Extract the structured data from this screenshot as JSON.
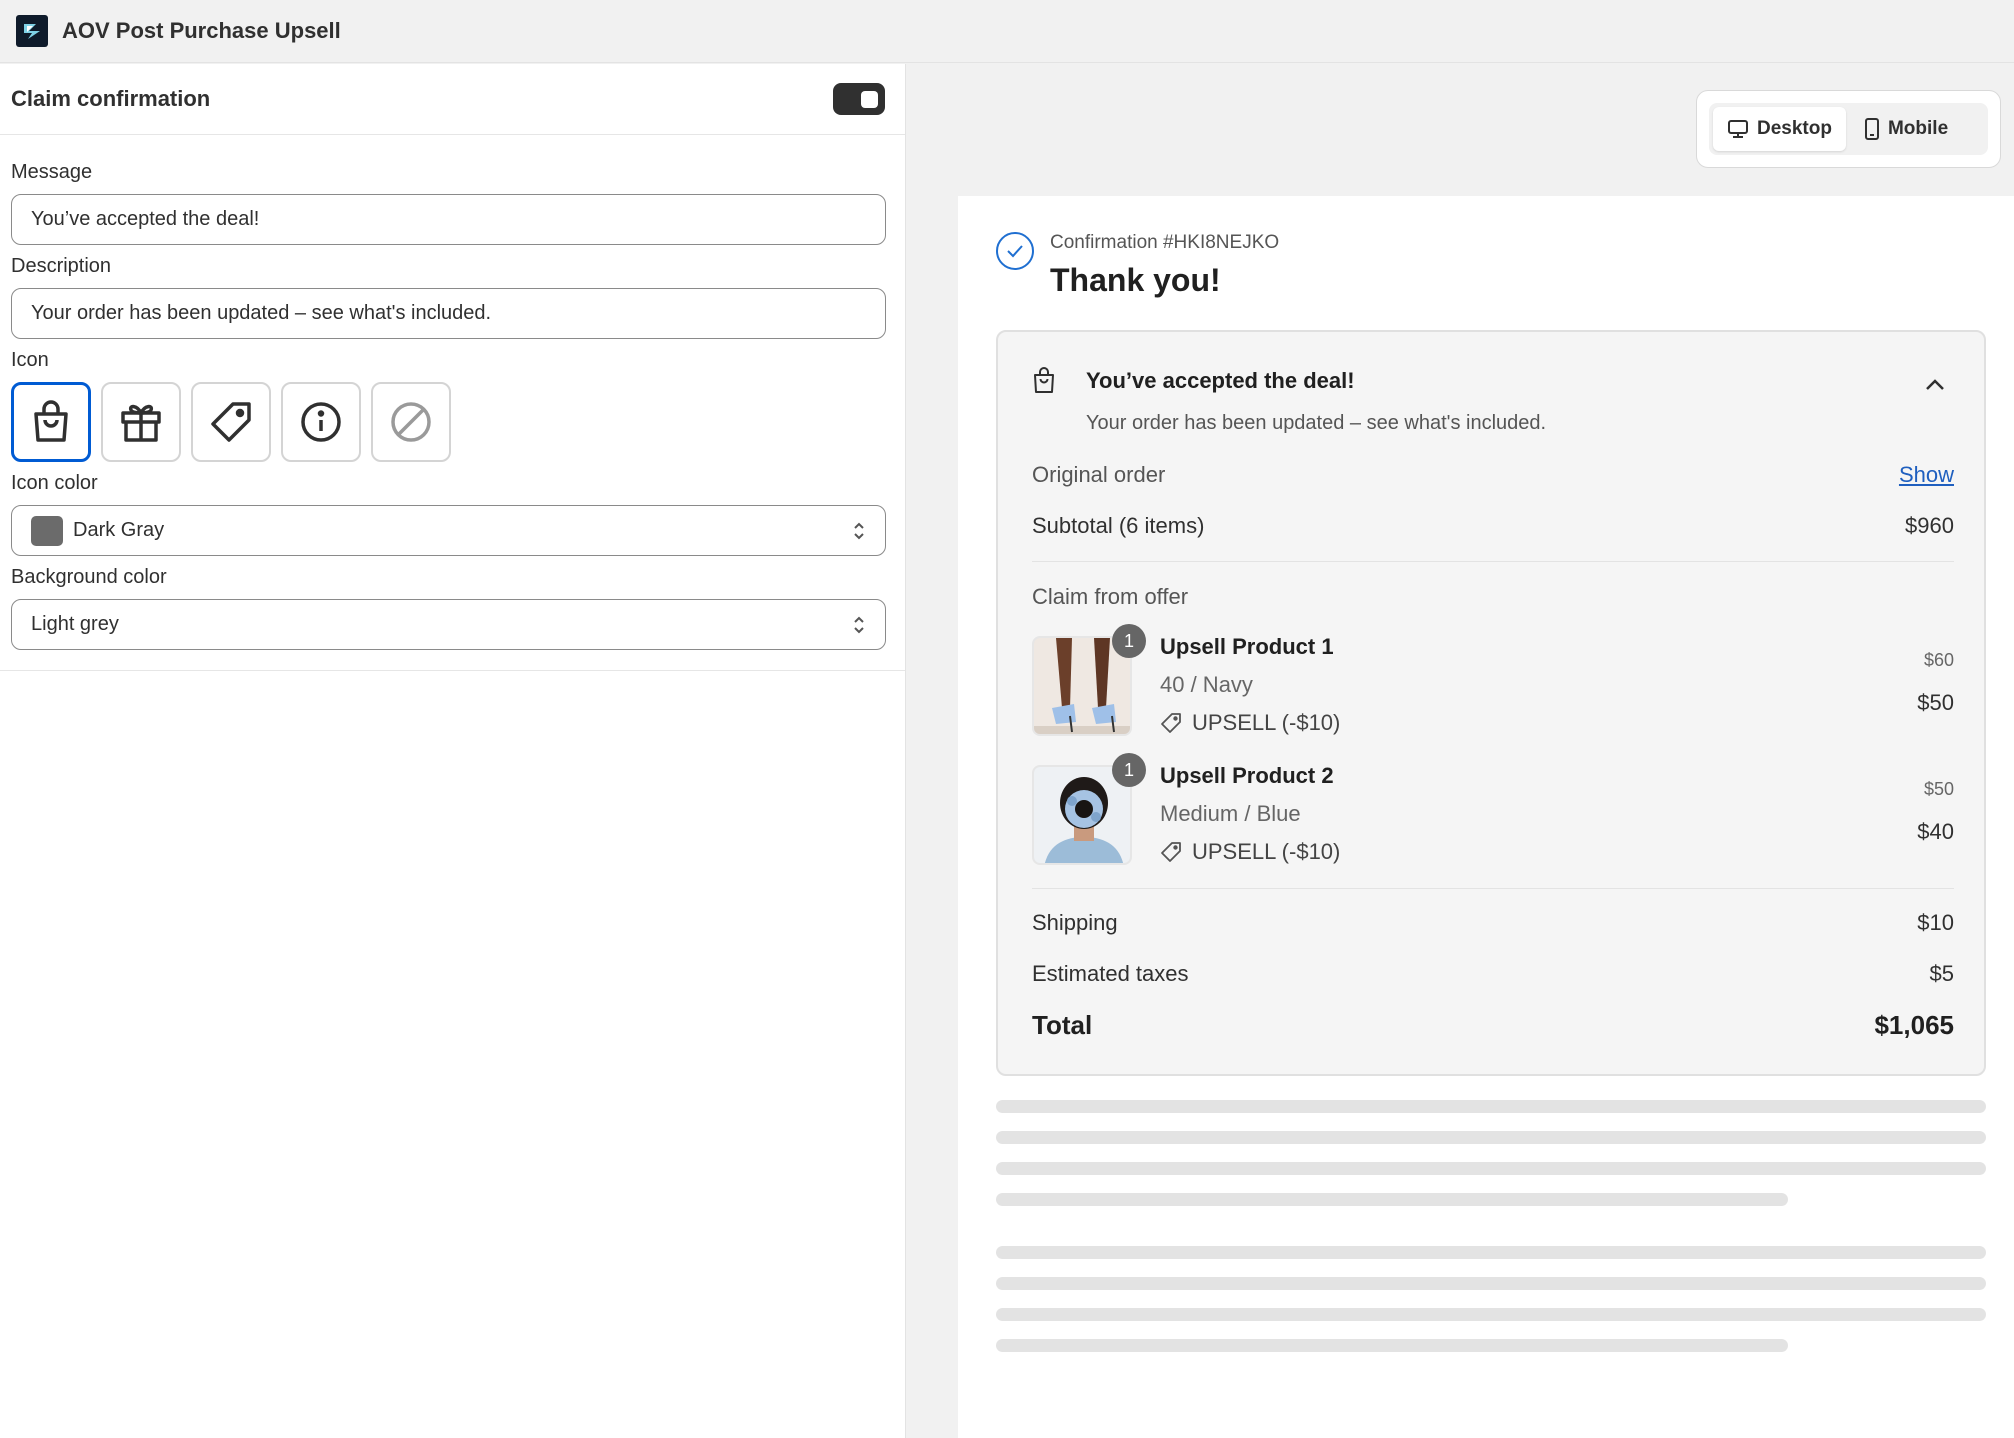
{
  "app": {
    "title": "AOV Post Purchase Upsell"
  },
  "settings": {
    "section_title": "Claim confirmation",
    "enabled": true,
    "message_label": "Message",
    "message_value": "You’ve accepted the deal!",
    "description_label": "Description",
    "description_value": "Your order has been updated – see what's included.",
    "icon_label": "Icon",
    "icons": [
      "bag-icon",
      "gift-icon",
      "tag-icon",
      "info-icon",
      "none-icon"
    ],
    "selected_icon": "bag-icon",
    "icon_color_label": "Icon color",
    "icon_color_value": "Dark Gray",
    "icon_color_hex": "#6b6b6b",
    "background_color_label": "Background color",
    "background_color_value": "Light grey"
  },
  "view_toggle": {
    "desktop": "Desktop",
    "mobile": "Mobile",
    "active": "Desktop"
  },
  "preview": {
    "confirmation_number": "Confirmation #HKI8NEJKO",
    "thank_you": "Thank you!",
    "deal_title": "You’ve accepted the deal!",
    "deal_description": "Your order has been updated – see what's included.",
    "original_order_label": "Original order",
    "show_link": "Show",
    "subtotal_label": "Subtotal (6 items)",
    "subtotal_value": "$960",
    "claim_label": "Claim from offer",
    "products": [
      {
        "qty": "1",
        "name": "Upsell Product 1",
        "variant": "40 / Navy",
        "discount": "UPSELL (-$10)",
        "old_price": "$60",
        "new_price": "$50"
      },
      {
        "qty": "1",
        "name": "Upsell Product 2",
        "variant": "Medium / Blue",
        "discount": "UPSELL (-$10)",
        "old_price": "$50",
        "new_price": "$40"
      }
    ],
    "shipping_label": "Shipping",
    "shipping_value": "$10",
    "taxes_label": "Estimated taxes",
    "taxes_value": "$5",
    "total_label": "Total",
    "total_value": "$1,065"
  },
  "colors": {
    "accent": "#005bd3",
    "link": "#1f5fbf",
    "toggle_on": "#303030"
  }
}
